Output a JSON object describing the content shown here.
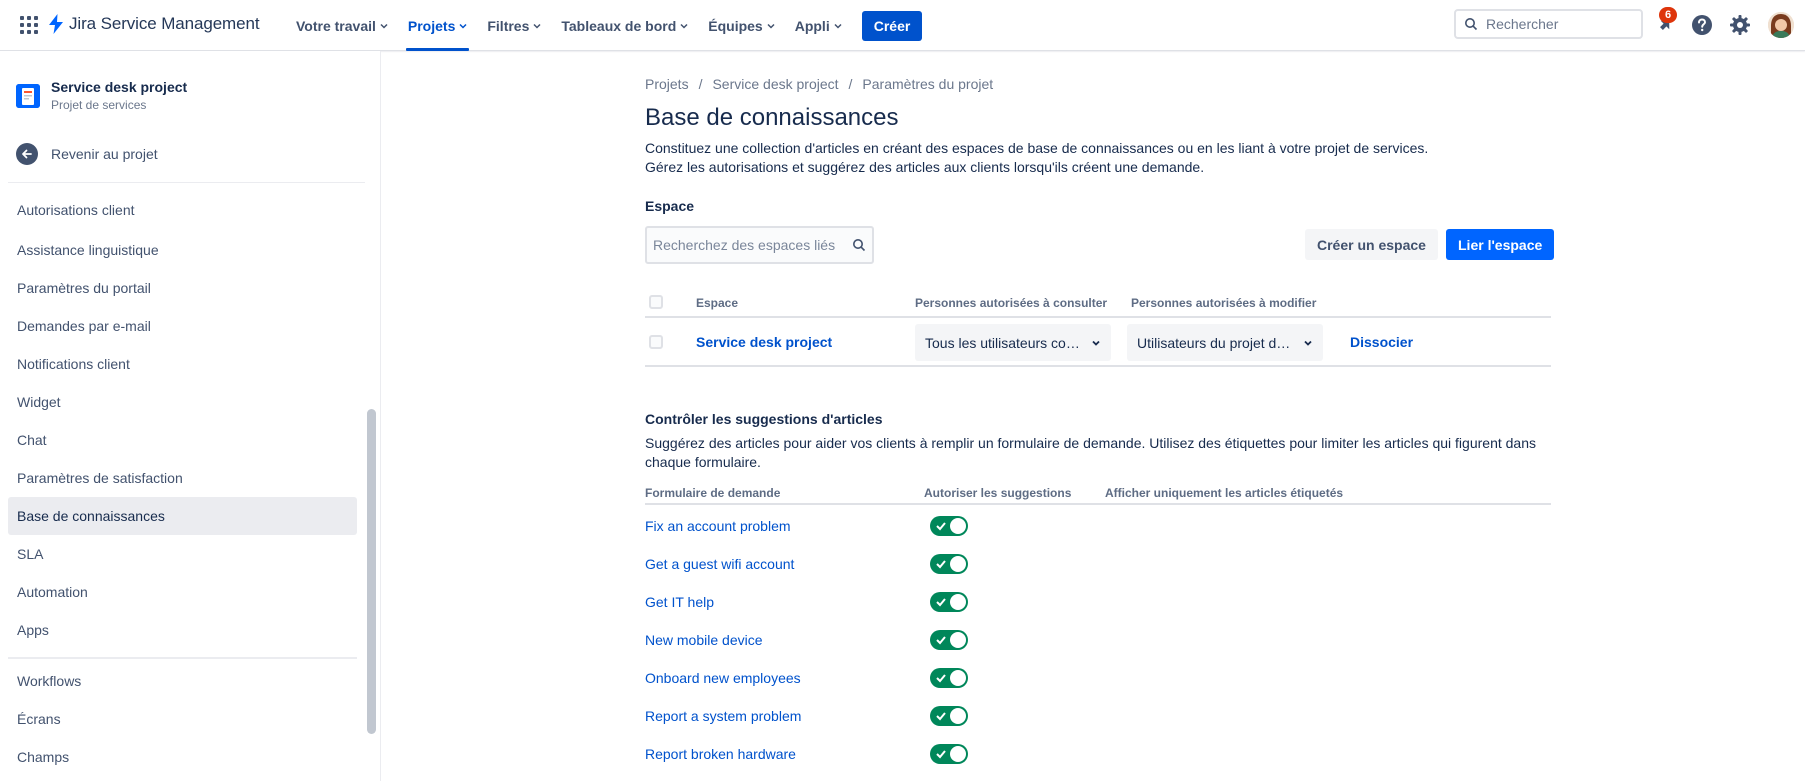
{
  "nav": {
    "app_name": "Jira Service Management",
    "items": [
      {
        "label": "Votre travail",
        "active": false
      },
      {
        "label": "Projets",
        "active": true
      },
      {
        "label": "Filtres",
        "active": false
      },
      {
        "label": "Tableaux de bord",
        "active": false
      },
      {
        "label": "Équipes",
        "active": false
      },
      {
        "label": "Appli",
        "active": false
      }
    ],
    "create_label": "Créer",
    "search_placeholder": "Rechercher",
    "notification_count": "6",
    "icons": [
      "app-switcher-icon",
      "jira-logo-icon",
      "search-icon",
      "notification-icon",
      "help-icon",
      "settings-icon"
    ]
  },
  "sidebar": {
    "project_name": "Service desk project",
    "project_type": "Projet de services",
    "back_label": "Revenir au projet",
    "items": [
      "Autorisations client",
      "Assistance linguistique",
      "Paramètres du portail",
      "Demandes par e-mail",
      "Notifications client",
      "Widget",
      "Chat",
      "Paramètres de satisfaction",
      "Base de connaissances",
      "SLA",
      "Automation",
      "Apps"
    ],
    "selected": "Base de connaissances",
    "items_after_separator": [
      "Workflows",
      "Écrans",
      "Champs"
    ]
  },
  "main": {
    "breadcrumb": [
      "Projets",
      "Service desk project",
      "Paramètres du projet"
    ],
    "title": "Base de connaissances",
    "description_line1": "Constituez une collection d'articles en créant des espaces de base de connaissances ou en les liant à votre projet de services.",
    "description_line2": "Gérez les autorisations et suggérez des articles aux clients lorsqu'ils créent une demande.",
    "space_section_label": "Espace",
    "space_search_placeholder": "Recherchez des espaces liés",
    "create_space_label": "Créer un espace",
    "link_space_label": "Lier l'espace",
    "table": {
      "headers": [
        "Espace",
        "Personnes autorisées à consulter",
        "Personnes autorisées à modifier"
      ],
      "rows": [
        {
          "space": "Service desk project",
          "view": "Tous les utilisateurs co…",
          "edit": "Utilisateurs du projet d…",
          "action": "Dissocier"
        }
      ]
    },
    "suggestions": {
      "title": "Contrôler les suggestions d'articles",
      "desc_line1": "Suggérez des articles pour aider vos clients à remplir un formulaire de demande. Utilisez des étiquettes pour limiter les articles qui figurent dans",
      "desc_line2": "chaque formulaire.",
      "headers": [
        "Formulaire de demande",
        "Autoriser les suggestions",
        "Afficher uniquement les articles étiquetés"
      ],
      "forms": [
        {
          "name": "Fix an account problem",
          "enabled": true
        },
        {
          "name": "Get a guest wifi account",
          "enabled": true
        },
        {
          "name": "Get IT help",
          "enabled": true
        },
        {
          "name": "New mobile device",
          "enabled": true
        },
        {
          "name": "Onboard new employees",
          "enabled": true
        },
        {
          "name": "Report a system problem",
          "enabled": true
        },
        {
          "name": "Report broken hardware",
          "enabled": true
        }
      ]
    }
  },
  "colors": {
    "brand_blue": "#0052cc",
    "primary_button": "#0065ff",
    "toggle_on": "#00875a",
    "badge": "#de350b"
  }
}
